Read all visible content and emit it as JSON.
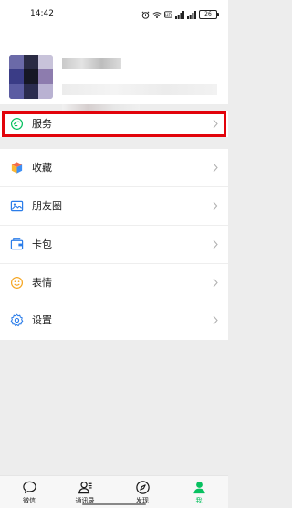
{
  "status_bar": {
    "time": "14:42",
    "battery": "26"
  },
  "menu": {
    "services": {
      "label": "服务",
      "icon": "services-icon"
    },
    "favorites": {
      "label": "收藏",
      "icon": "favorites-box-icon"
    },
    "moments": {
      "label": "朋友圈",
      "icon": "moments-photo-icon"
    },
    "cards": {
      "label": "卡包",
      "icon": "wallet-icon"
    },
    "stickers": {
      "label": "表情",
      "icon": "smiley-icon"
    },
    "settings": {
      "label": "设置",
      "icon": "gear-icon"
    }
  },
  "tabbar": {
    "chats": "微信",
    "contacts": "通讯录",
    "discover": "发现",
    "me": "我"
  },
  "colors": {
    "accent": "#07c160",
    "highlight": "#e2030b",
    "background": "#ededed"
  }
}
